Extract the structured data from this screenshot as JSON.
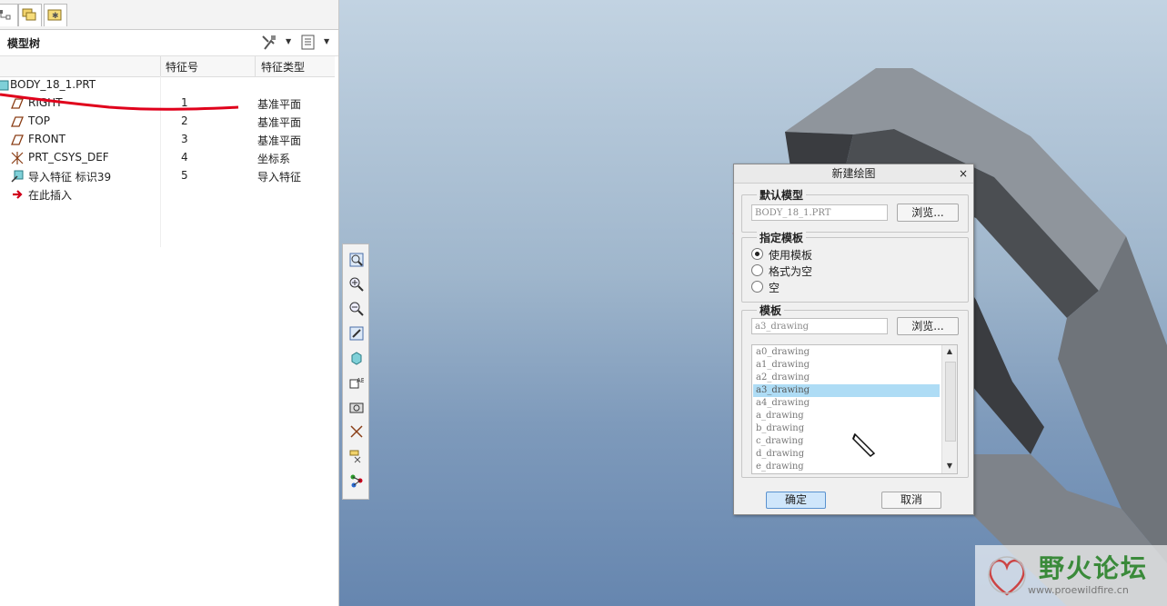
{
  "model_tree": {
    "title": "模型树",
    "columns": [
      "特征号",
      "特征类型"
    ],
    "root": "BODY_18_1.PRT",
    "items": [
      {
        "name": "RIGHT",
        "num": "1",
        "type": "基准平面",
        "icon": "datum-plane-icon"
      },
      {
        "name": "TOP",
        "num": "2",
        "type": "基准平面",
        "icon": "datum-plane-icon"
      },
      {
        "name": "FRONT",
        "num": "3",
        "type": "基准平面",
        "icon": "datum-plane-icon"
      },
      {
        "name": "PRT_CSYS_DEF",
        "num": "4",
        "type": "坐标系",
        "icon": "csys-icon"
      },
      {
        "name": "导入特征 标识39",
        "num": "5",
        "type": "导入特征",
        "icon": "import-feature-icon"
      }
    ],
    "insert_here": "在此插入"
  },
  "dialog": {
    "title": "新建绘图",
    "close": "×",
    "default_model_label": "默认模型",
    "default_model_value": "BODY_18_1.PRT",
    "browse": "浏览...",
    "template_spec_label": "指定模板",
    "options": [
      "使用模板",
      "格式为空",
      "空"
    ],
    "selected_option": 0,
    "template_label": "模板",
    "template_value": "a3_drawing",
    "template_list": [
      "a0_drawing",
      "a1_drawing",
      "a2_drawing",
      "a3_drawing",
      "a4_drawing",
      "a_drawing",
      "b_drawing",
      "c_drawing",
      "d_drawing",
      "e_drawing"
    ],
    "selected_template": "a3_drawing",
    "ok": "确定",
    "cancel": "取消"
  },
  "watermark": {
    "title": "野火论坛",
    "url": "www.proewildfire.cn"
  },
  "colors": {
    "selection": "#aedcf5",
    "annotation_red": "#e0001b",
    "viewport_top": "#c2d3e2",
    "viewport_bottom": "#6686af"
  }
}
